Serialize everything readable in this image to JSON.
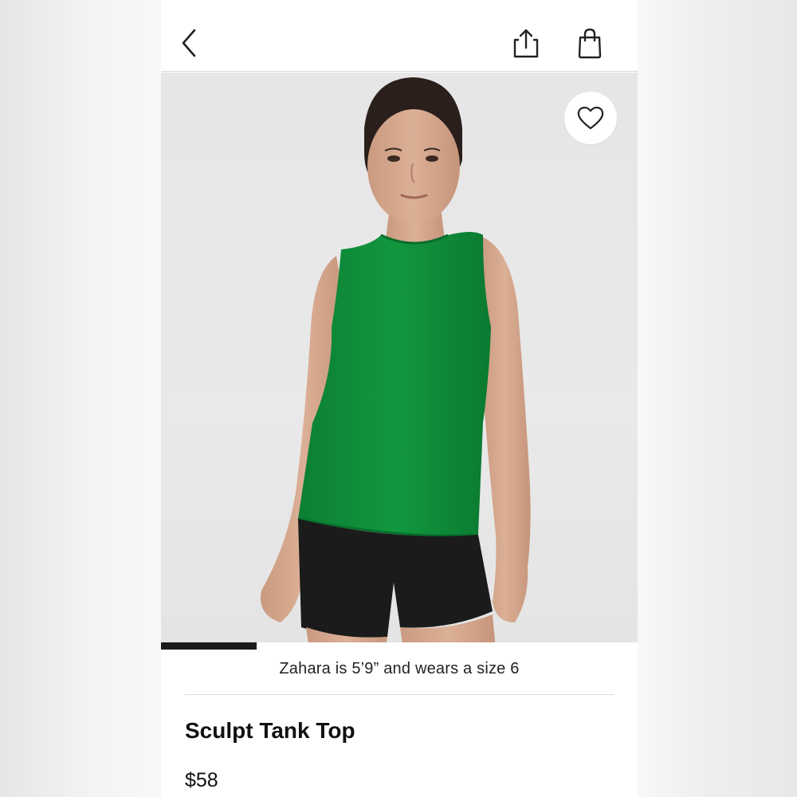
{
  "header": {
    "back_icon": "chevron-left-icon",
    "share_icon": "share-icon",
    "bag_icon": "shopping-bag-icon"
  },
  "gallery": {
    "favorite_icon": "heart-icon",
    "image_alt": "Model wearing green sleeveless tank top and black shorts",
    "progress": 0.2
  },
  "product": {
    "fit_note": "Zahara is 5’9” and wears a size 6",
    "title": "Sculpt Tank Top",
    "price": "$58"
  },
  "colors": {
    "tank": "#0f8a3a",
    "shorts": "#1b1b1b",
    "background": "#e7e7e7",
    "text": "#111111"
  }
}
